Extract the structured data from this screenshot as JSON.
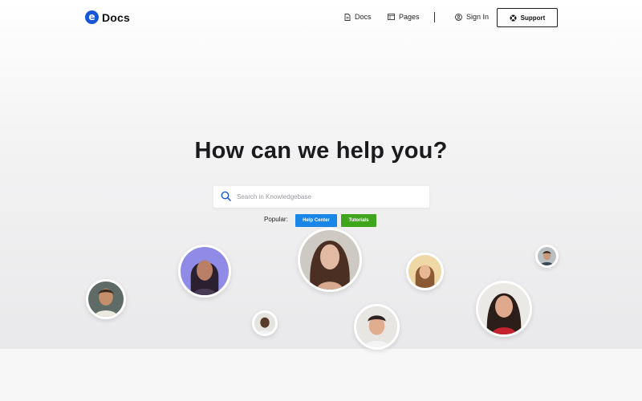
{
  "brand": {
    "logo_letter": "e",
    "name": "Docs",
    "accent": "#1656d6"
  },
  "nav": {
    "docs_label": "Docs",
    "pages_label": "Pages",
    "signin_label": "Sign In",
    "support_label": "Support"
  },
  "hero": {
    "headline": "How can we help you?",
    "search_placeholder": "Search in Knowledgebase",
    "popular_label": "Popular:",
    "tags": [
      {
        "label": "Help Center",
        "color": "#1a86e8"
      },
      {
        "label": "Tutorials",
        "color": "#3fa51d"
      }
    ]
  }
}
